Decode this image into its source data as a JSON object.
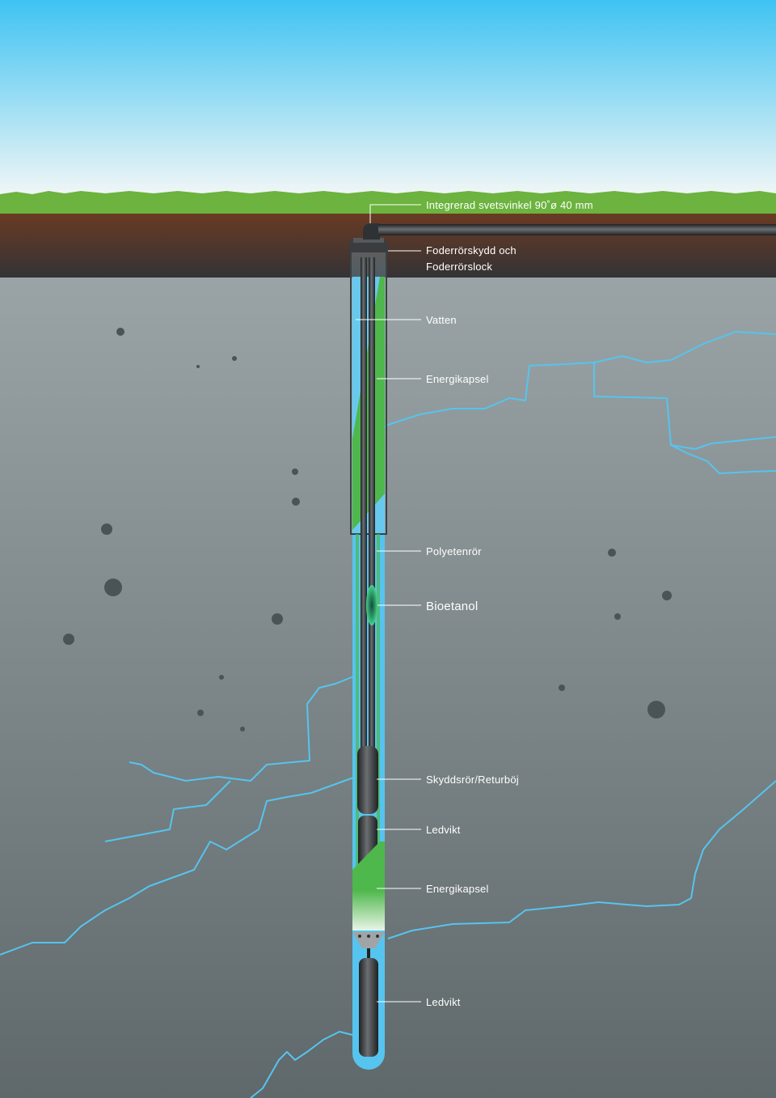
{
  "labels": {
    "elbow": "Integrerad svetsvinkel 90˚ø 40 mm",
    "cap_line1": "Foderrörskydd och",
    "cap_line2": "Foderrörslock",
    "water": "Vatten",
    "energy_capsule_top": "Energikapsel",
    "pe_pipe": "Polyetenrör",
    "bioethanol": "Bioetanol",
    "protective_tube": "Skyddsrör/Returböj",
    "weight_upper": "Ledvikt",
    "energy_capsule_bottom": "Energikapsel",
    "weight_lower": "Ledvikt"
  },
  "colors": {
    "sky_top": "#3ec3f2",
    "sky_bottom": "#f4f7f6",
    "grass": "#6cb33f",
    "soil_top": "#6a3a23",
    "soil_bottom": "#333336",
    "rock_top": "#9aa4a6",
    "rock_bottom": "#5f686a",
    "water": "#56c4ef",
    "capsule_green": "#4fb84d",
    "pipe_dark": "#2a2c2e",
    "leader_line": "#ffffff"
  }
}
